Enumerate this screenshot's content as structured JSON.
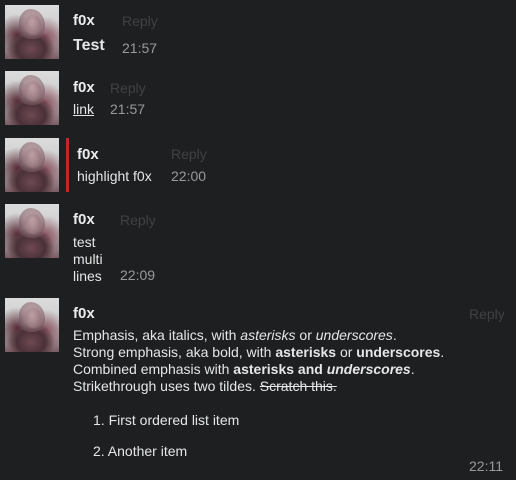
{
  "messages": [
    {
      "author": "f0x",
      "reply": "Reply",
      "text": "Test",
      "time": "21:57"
    },
    {
      "author": "f0x",
      "reply": "Reply",
      "link": "link",
      "time": "21:57"
    },
    {
      "author": "f0x",
      "reply": "Reply",
      "text": "highlight f0x",
      "time": "22:00",
      "highlight_color": "#c0262c"
    },
    {
      "author": "f0x",
      "reply": "Reply",
      "lines": [
        "test",
        "multi",
        "lines"
      ],
      "time": "22:09"
    },
    {
      "author": "f0x",
      "reply": "Reply",
      "time": "22:11",
      "markdown": {
        "l1": {
          "a": "Emphasis, aka italics, with ",
          "b": "asterisks",
          "c": " or ",
          "d": "underscores",
          "e": "."
        },
        "l2": {
          "a": "Strong emphasis, aka bold, with ",
          "b": "asterisks",
          "c": " or ",
          "d": "underscores",
          "e": "."
        },
        "l3": {
          "a": "Combined emphasis with ",
          "b": "asterisks and ",
          "c": "underscores",
          "d": "."
        },
        "l4": {
          "a": "Strikethrough uses two tildes. ",
          "b": "Scratch this."
        },
        "ordered_list": [
          "1. First ordered list item",
          "2. Another item"
        ]
      }
    }
  ]
}
